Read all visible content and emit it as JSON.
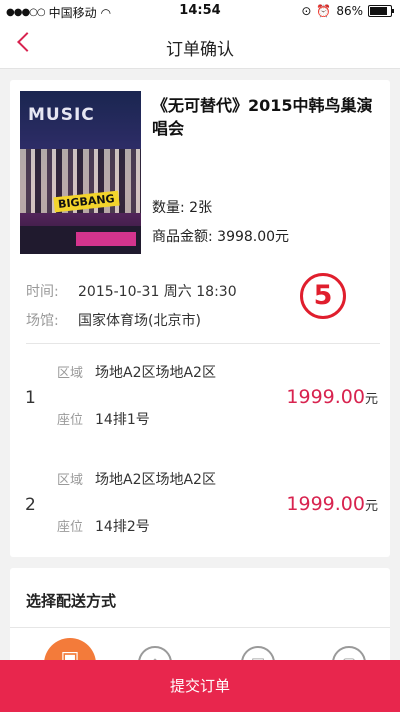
{
  "status_bar": {
    "carrier": "中国移动",
    "time": "14:54",
    "battery": "86%",
    "battery_level": 0.86
  },
  "nav": {
    "title": "订单确认",
    "back_icon": "chevron-left-icon"
  },
  "order": {
    "title": "《无可替代》2015中韩鸟巢演唱会",
    "quantity": "数量: 2张",
    "amount": "商品金额: 3998.00元",
    "poster_text": {
      "headline": "MUSIC",
      "band": "BIGBANG"
    },
    "time_label": "时间:",
    "time_value": "2015-10-31 周六 18:30",
    "venue_label": "场馆:",
    "venue_value": "国家体育场(北京市)",
    "marker": "⑤"
  },
  "tickets": [
    {
      "index": "1",
      "zone_label": "区域",
      "zone": "场地A2区场地A2区",
      "seat_label": "座位",
      "seat": "14排1号",
      "price": "1999.00",
      "unit": "元"
    },
    {
      "index": "2",
      "zone_label": "区域",
      "zone": "场地A2区场地A2区",
      "seat_label": "座位",
      "seat": "14排2号",
      "price": "1999.00",
      "unit": "元"
    }
  ],
  "delivery": {
    "title": "选择配送方式",
    "options": [
      {
        "icon": "ticket-pickup-icon",
        "selected": true
      },
      {
        "icon": "tag-icon",
        "selected": false
      },
      {
        "icon": "express-icon",
        "selected": false
      },
      {
        "icon": "e-ticket-icon",
        "selected": false
      }
    ]
  },
  "submit": {
    "label": "提交订单"
  },
  "colors": {
    "accent": "#e8264d",
    "price": "#d8234f",
    "selected_option": "#f37b3a",
    "marker": "#e01e2d"
  }
}
